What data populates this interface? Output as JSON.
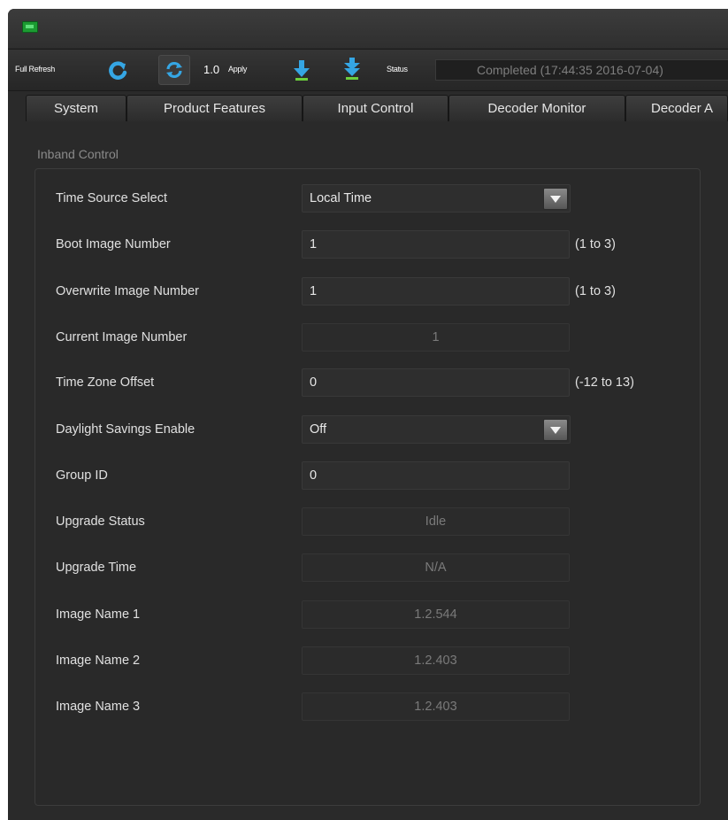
{
  "toolbar": {
    "full_refresh_label": "Full Refresh",
    "version_label": "1.0",
    "apply_label": "Apply",
    "status_label": "Status",
    "status_value": "Completed  (17:44:35  2016-07-04)"
  },
  "tabs": [
    "System",
    "Product Features",
    "Input Control",
    "Decoder Monitor",
    "Decoder A"
  ],
  "panel": {
    "title": "Inband Control",
    "rows": [
      {
        "label": "Time Source Select",
        "value": "Local Time",
        "kind": "dropdown"
      },
      {
        "label": "Boot Image Number",
        "value": "1",
        "kind": "input",
        "range": "(1 to 3)"
      },
      {
        "label": "Overwrite Image Number",
        "value": "1",
        "kind": "input",
        "range": "(1 to 3)"
      },
      {
        "label": "Current Image Number",
        "value": "1",
        "kind": "readonly"
      },
      {
        "label": "Time Zone Offset",
        "value": "0",
        "kind": "input",
        "range": "(-12 to 13)"
      },
      {
        "label": "Daylight Savings Enable",
        "value": "Off",
        "kind": "dropdown"
      },
      {
        "label": "Group ID",
        "value": "0",
        "kind": "input"
      },
      {
        "label": "Upgrade Status",
        "value": "Idle",
        "kind": "readonly"
      },
      {
        "label": "Upgrade Time",
        "value": "N/A",
        "kind": "readonly"
      },
      {
        "label": "Image Name 1",
        "value": "1.2.544",
        "kind": "readonly"
      },
      {
        "label": "Image Name 2",
        "value": "1.2.403",
        "kind": "readonly"
      },
      {
        "label": "Image Name 3",
        "value": "1.2.403",
        "kind": "readonly"
      }
    ]
  },
  "icons": {
    "app": "chip-icon",
    "refresh_full": "refresh-arrow-icon",
    "refresh_auto": "sync-icon",
    "download_one": "download-arrow-icon",
    "download_all": "download-double-arrow-icon",
    "dropdown": "chevron-down-icon"
  },
  "colors": {
    "background": "#2a2a2a",
    "accent_blue": "#35a6e4",
    "accent_green": "#6ccf3c",
    "text": "#e0e0e0",
    "readonly_text": "#7a7a7a"
  }
}
